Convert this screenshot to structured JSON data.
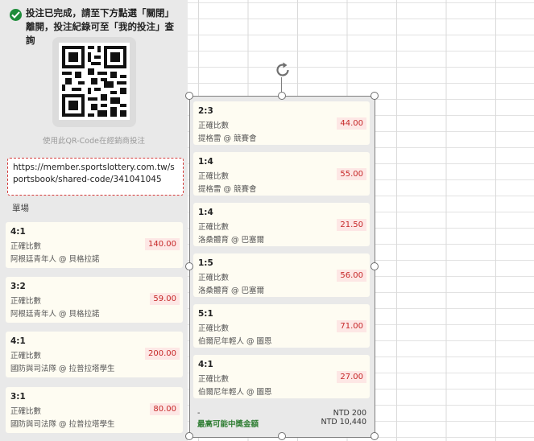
{
  "success_message": "投注已完成，請至下方點選「關閉」離開，投注紀錄可至「我的投注」查詢",
  "qr_caption": "使用此QR-Code在經銷商投注",
  "share_url": "https://member.sportslottery.com.tw/sportsbook/shared-code/341041045",
  "section_label": "單場",
  "singles": [
    {
      "score": "4:1",
      "market": "正確比數",
      "match": "阿根廷青年人 @ 貝格拉諾",
      "odds": "140.00"
    },
    {
      "score": "3:2",
      "market": "正確比數",
      "match": "阿根廷青年人 @ 貝格拉諾",
      "odds": "59.00"
    },
    {
      "score": "4:1",
      "market": "正確比數",
      "match": "國防與司法隊 @ 拉普拉塔學生",
      "odds": "200.00"
    },
    {
      "score": "3:1",
      "market": "正確比數",
      "match": "國防與司法隊 @ 拉普拉塔學生",
      "odds": "80.00"
    }
  ],
  "panel_bets": [
    {
      "score": "2:3",
      "market": "正確比數",
      "match": "提格雷 @ 競賽會",
      "odds": "44.00"
    },
    {
      "score": "1:4",
      "market": "正確比數",
      "match": "提格雷 @ 競賽會",
      "odds": "55.00"
    },
    {
      "score": "1:4",
      "market": "正確比數",
      "match": "洛桑體育 @ 巴塞爾",
      "odds": "21.50"
    },
    {
      "score": "1:5",
      "market": "正確比數",
      "match": "洛桑體育 @ 巴塞爾",
      "odds": "56.00"
    },
    {
      "score": "5:1",
      "market": "正確比數",
      "match": "伯爾尼年輕人 @ 圖恩",
      "odds": "71.00"
    },
    {
      "score": "4:1",
      "market": "正確比數",
      "match": "伯爾尼年輕人 @ 圖恩",
      "odds": "27.00"
    }
  ],
  "summary": {
    "stake_label": "-",
    "stake_value": "NTD 200",
    "max_label": "最高可能中獎金額",
    "max_value": "NTD 10,440"
  },
  "colors": {
    "panel_bg": "#e9e9e9",
    "card_bg": "#fefcf2",
    "odds_bg": "#fde7e5",
    "odds_text": "#c62828",
    "success": "#1e8c3a",
    "dashed_border": "#d43b3b",
    "max_label": "#2e7d32"
  }
}
